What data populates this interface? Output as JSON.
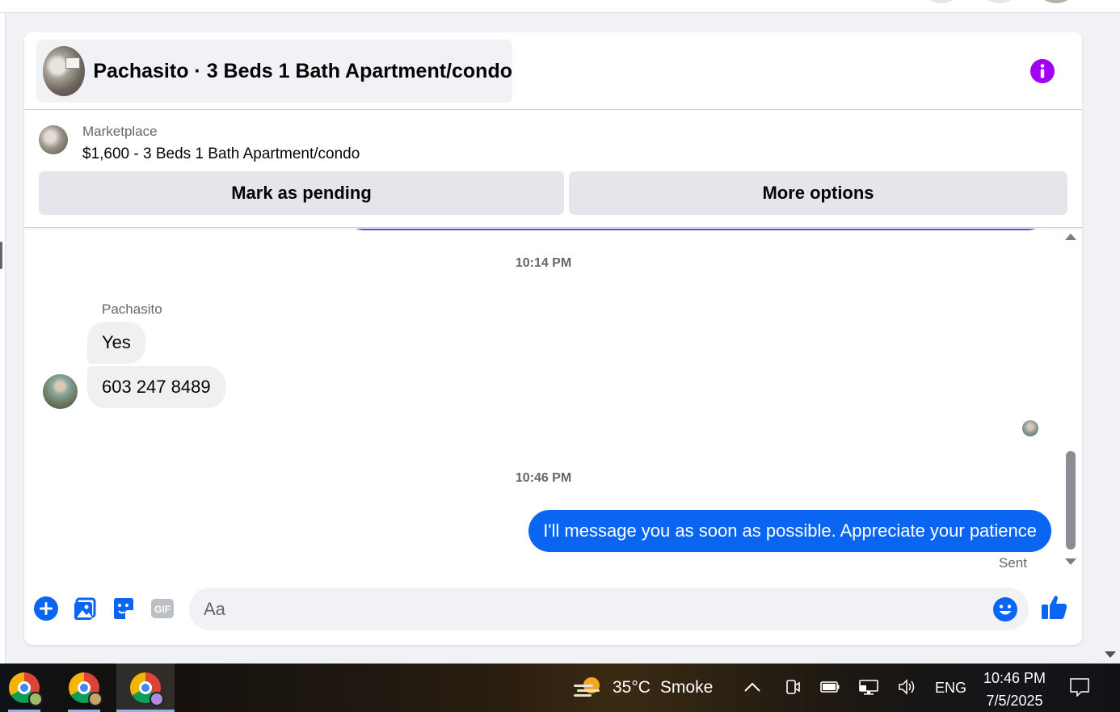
{
  "header": {
    "title": "Pachasito · 3 Beds 1 Bath Apartment/condo",
    "info_icon": "info-icon"
  },
  "listing": {
    "label": "Marketplace",
    "price_line": "$1,600 - 3 Beds 1 Bath Apartment/condo",
    "mark_pending_label": "Mark as pending",
    "more_options_label": "More options"
  },
  "thread": {
    "timestamp_1": "10:14 PM",
    "sender_name": "Pachasito",
    "incoming": [
      {
        "text": "Yes"
      },
      {
        "text": "603 247 8489"
      }
    ],
    "timestamp_2": "10:46 PM",
    "outgoing": [
      {
        "text": "I'll message you as soon as possible. Appreciate your patience"
      }
    ],
    "status": "Sent"
  },
  "composer": {
    "placeholder": "Aa",
    "icons": [
      "plus-icon",
      "photo-icon",
      "sticker-icon",
      "gif-icon",
      "emoji-icon",
      "thumbs-up-icon"
    ],
    "gif_label": "GIF"
  },
  "colors": {
    "accent_blue": "#0a66f0",
    "info_purple": "#a100f2",
    "bubble_gray": "#f0f0f0",
    "button_gray": "#e4e6eb"
  },
  "taskbar": {
    "weather": {
      "temp": "35°C",
      "condition": "Smoke"
    },
    "language": "ENG",
    "time": "10:46 PM",
    "date": "7/5/2025"
  }
}
